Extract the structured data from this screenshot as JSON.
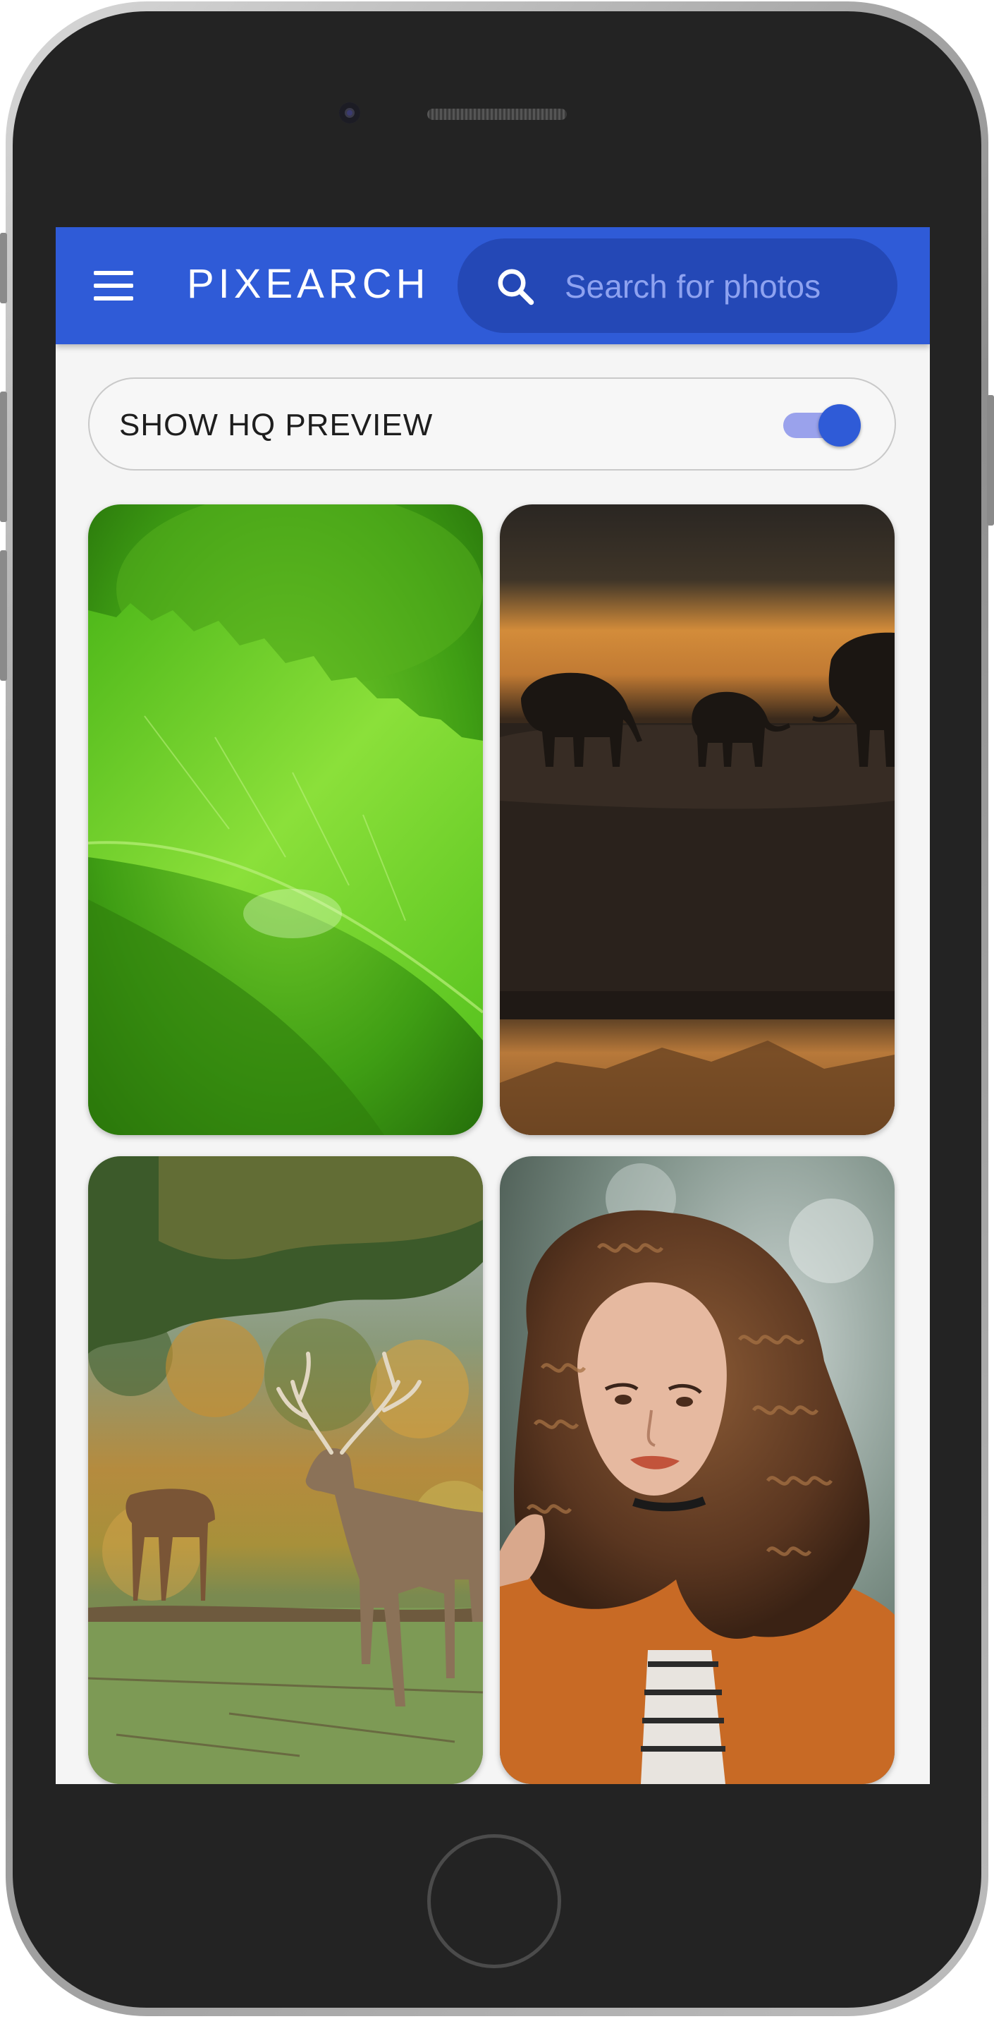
{
  "app": {
    "title": "PIXEARCH"
  },
  "search": {
    "placeholder": "Search for photos",
    "value": ""
  },
  "settings": {
    "hq_preview_label": "SHOW HQ PREVIEW",
    "hq_preview_enabled": true
  },
  "photos": [
    {
      "subject": "green leaf close-up"
    },
    {
      "subject": "elephants silhouette at sunset"
    },
    {
      "subject": "deer in autumn meadow"
    },
    {
      "subject": "woman with curly hair"
    }
  ],
  "colors": {
    "appbar": "#2f5bd7",
    "search_box": "#2448b6",
    "toggle_track": "#9aa2ec",
    "toggle_thumb": "#2f5bd7"
  },
  "icons": [
    "menu-icon",
    "search-icon"
  ]
}
